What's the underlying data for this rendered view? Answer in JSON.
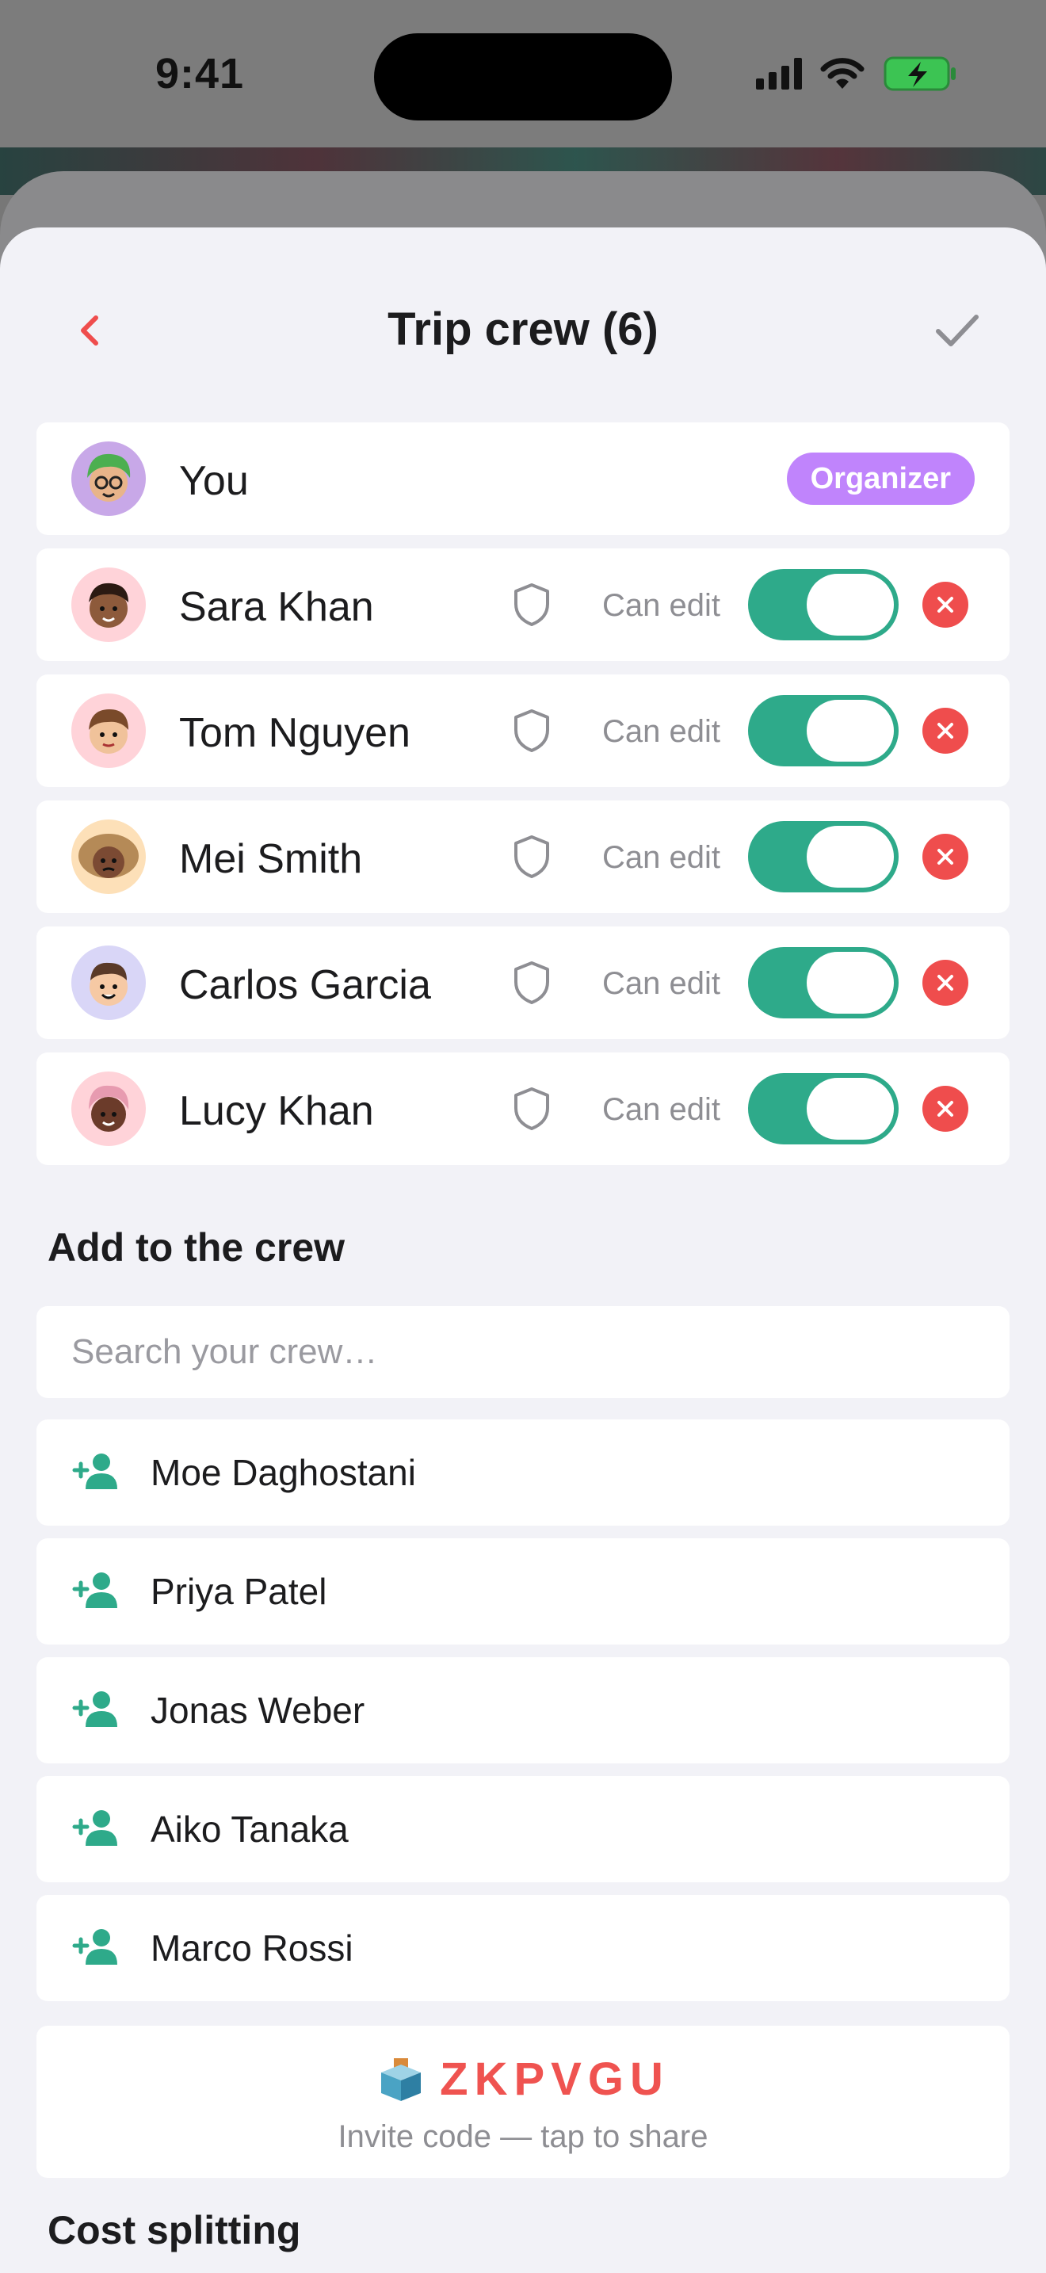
{
  "status_bar": {
    "time": "9:41"
  },
  "header": {
    "title": "Trip crew (6)"
  },
  "members": [
    {
      "name": "You",
      "role": "Organizer",
      "avatar_bg": "#c8a8e8",
      "avatar": "avatar-green-hair-glasses"
    },
    {
      "name": "Sara Khan",
      "permission": "Can edit",
      "enabled": true,
      "avatar_bg": "#ffd3d9",
      "avatar": "avatar-dark-hair"
    },
    {
      "name": "Tom Nguyen",
      "permission": "Can edit",
      "enabled": true,
      "avatar_bg": "#ffd3d9",
      "avatar": "avatar-brown-hair"
    },
    {
      "name": "Mei Smith",
      "permission": "Can edit",
      "enabled": true,
      "avatar_bg": "#fde0b8",
      "avatar": "avatar-curly-hair"
    },
    {
      "name": "Carlos Garcia",
      "permission": "Can edit",
      "enabled": true,
      "avatar_bg": "#d9d6f7",
      "avatar": "avatar-short-hair"
    },
    {
      "name": "Lucy Khan",
      "permission": "Can edit",
      "enabled": true,
      "avatar_bg": "#ffd3d9",
      "avatar": "avatar-pink-hair"
    }
  ],
  "add_section": {
    "title": "Add to the crew",
    "search_placeholder": "Search your crew…",
    "candidates": [
      "Moe Daghostani",
      "Priya Patel",
      "Jonas Weber",
      "Aiko Tanaka",
      "Marco Rossi"
    ]
  },
  "invite": {
    "code": "ZKPVGU",
    "hint": "Invite code — tap to share"
  },
  "next_section": {
    "title": "Cost splitting"
  },
  "colors": {
    "accent_green": "#2eaa8a",
    "danger_red": "#ef4d4d",
    "organizer_purple": "#c084fc",
    "code_red": "#ef5350"
  }
}
